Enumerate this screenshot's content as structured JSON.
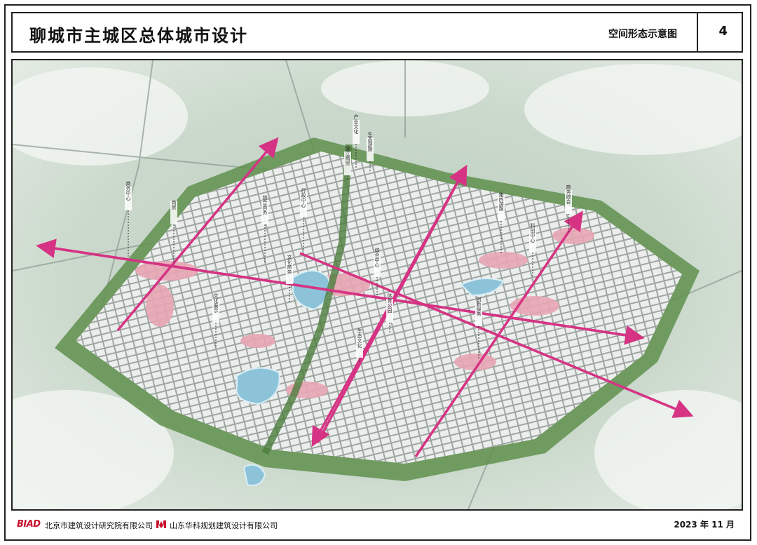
{
  "header": {
    "title": "聊城市主城区总体城市设计",
    "subtitle": "空间形态示意图",
    "page_number": "4"
  },
  "map_labels": [
    "产业文化",
    "生态游憩",
    "滨江商贸",
    "商务中心",
    "商贸",
    "综合商务",
    "行政中心",
    "文化商务",
    "综合中心",
    "体育公园",
    "创新服务",
    "休闲游憩",
    "商务综合",
    "文化展示",
    "科创中心",
    "生态文化"
  ],
  "footer": {
    "org1_logo": "BIAD",
    "org1_name": "北京市建筑设计研究院有限公司",
    "org2_name": "山东华科规划建筑设计有限公司",
    "date": "2023 年 11 月"
  },
  "colors": {
    "axis": "#d63384",
    "water": "#8cc3d9",
    "urban": "#e6e8e6",
    "green": "#6f9e5a",
    "accent": "#c8102e"
  }
}
